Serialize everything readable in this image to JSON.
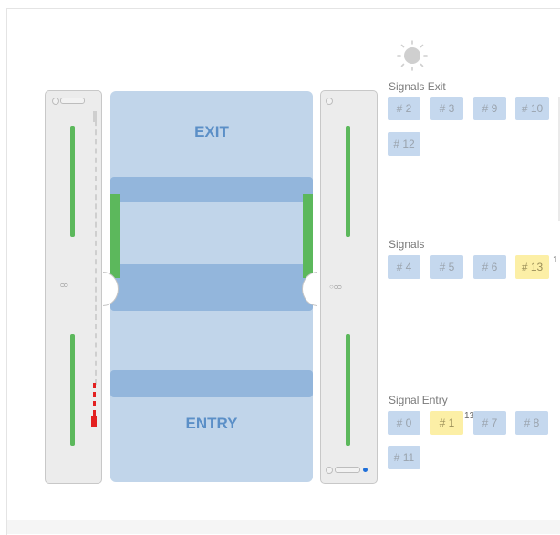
{
  "lane": {
    "exit_label": "EXIT",
    "entry_label": "ENTRY"
  },
  "left_pillar": {
    "middle_glyph": "ᴑᴑ"
  },
  "right_pillar": {
    "middle_glyph": "○ ᴑᴑ"
  },
  "groups": {
    "exit": {
      "title": "Signals Exit",
      "signals": [
        {
          "label": "# 2",
          "active": false
        },
        {
          "label": "# 3",
          "active": false
        },
        {
          "label": "# 9",
          "active": false
        },
        {
          "label": "# 10",
          "active": false
        },
        {
          "label": "# 12",
          "active": false
        }
      ]
    },
    "middle": {
      "title": "Signals",
      "signals": [
        {
          "label": "# 4",
          "active": false
        },
        {
          "label": "# 5",
          "active": false
        },
        {
          "label": "# 6",
          "active": false
        },
        {
          "label": "# 13",
          "active": true,
          "note": "1"
        }
      ]
    },
    "entry": {
      "title": "Signal Entry",
      "signals": [
        {
          "label": "# 0",
          "active": false
        },
        {
          "label": "# 1",
          "active": true,
          "note": "13"
        },
        {
          "label": "# 7",
          "active": false
        },
        {
          "label": "# 8",
          "active": false
        },
        {
          "label": "# 11",
          "active": false
        }
      ]
    }
  },
  "colors": {
    "lane": "#c1d5ea",
    "band": "#93b6dc",
    "signal_off": "#c5d8ee",
    "signal_on": "#fcefa6",
    "green": "#5cb85c",
    "alert": "#e32020"
  }
}
